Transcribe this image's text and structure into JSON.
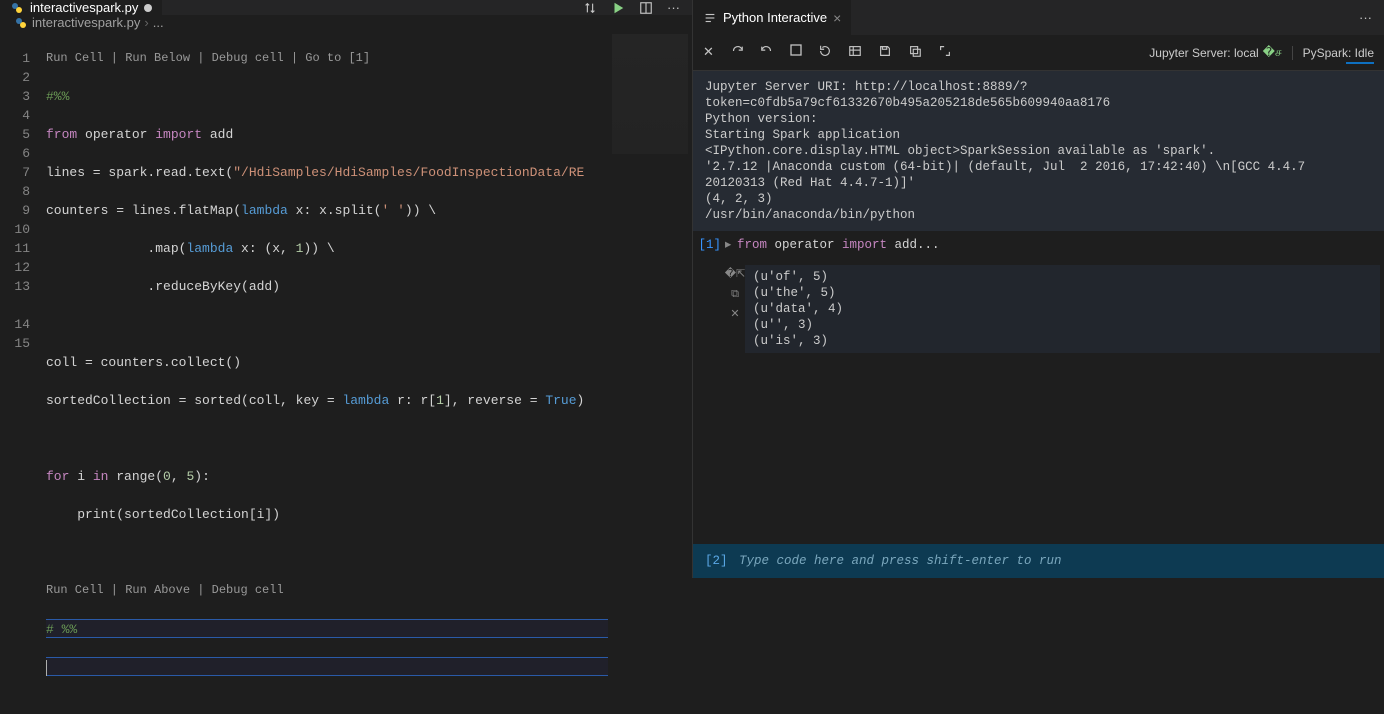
{
  "left": {
    "tab": {
      "filename": "interactivespark.py",
      "dirty": true
    },
    "breadcrumb": {
      "file": "interactivespark.py",
      "rest": "..."
    },
    "codelens1": {
      "runCell": "Run Cell",
      "runBelow": "Run Below",
      "debug": "Debug cell",
      "goto": "Go to [1]"
    },
    "codelens2": {
      "runCell": "Run Cell",
      "runAbove": "Run Above",
      "debug": "Debug cell"
    },
    "lines": {
      "l1_comment": "#%%",
      "l2_from": "from",
      "l2_operator": " operator ",
      "l2_import": "import",
      "l2_add": " add",
      "l3_a": "lines = spark.read.text(",
      "l3_str": "\"/HdiSamples/HdiSamples/FoodInspectionData/RE",
      "l3_b": "",
      "l4_a": "counters = lines.flatMap(",
      "l4_lambda": "lambda",
      "l4_b": " x: x.split(",
      "l4_str": "' '",
      "l4_c": ")) \\",
      "l5_a": "             .map(",
      "l5_lambda": "lambda",
      "l5_b": " x: (x, ",
      "l5_num": "1",
      "l5_c": ")) \\",
      "l6": "             .reduceByKey(add)",
      "l8": "coll = counters.collect()",
      "l9_a": "sortedCollection = sorted(coll, key = ",
      "l9_lambda": "lambda",
      "l9_b": " r: r[",
      "l9_num": "1",
      "l9_c": "], reverse = ",
      "l9_true": "True",
      "l9_d": ")",
      "l11_for": "for",
      "l11_a": " i ",
      "l11_in": "in",
      "l11_b": " range(",
      "l11_n0": "0",
      "l11_c": ", ",
      "l11_n1": "5",
      "l11_d": "):",
      "l12_a": "    print(sortedCollection[i])",
      "l14": "# %%"
    },
    "gutter": [
      "1",
      "2",
      "3",
      "4",
      "5",
      "6",
      "7",
      "8",
      "9",
      "10",
      "11",
      "12",
      "13",
      "14",
      "15"
    ]
  },
  "right": {
    "tabTitle": "Python Interactive",
    "server": {
      "label": "Jupyter Server: local"
    },
    "pyspark": {
      "label": "PySpark: Idle"
    },
    "outputText": "Jupyter Server URI: http://localhost:8889/?token=c0fdb5a79cf61332670b495a205218de565b609940aa8176\nPython version:\nStarting Spark application\n<IPython.core.display.HTML object>SparkSession available as 'spark'.\n'2.7.12 |Anaconda custom (64-bit)| (default, Jul  2 2016, 17:42:40) \\n[GCC 4.4.7 20120313 (Red Hat 4.4.7-1)]'\n(4, 2, 3)\n/usr/bin/anaconda/bin/python",
    "cell1": {
      "index": "[1]",
      "code_from": "from",
      "code_mid": " operator ",
      "code_import": "import",
      "code_rest": " add...",
      "output": "(u'of', 5)\n(u'the', 5)\n(u'data', 4)\n(u'', 3)\n(u'is', 3)"
    },
    "input": {
      "index": "[2]",
      "placeholder": "Type code here and press shift-enter to run"
    }
  }
}
